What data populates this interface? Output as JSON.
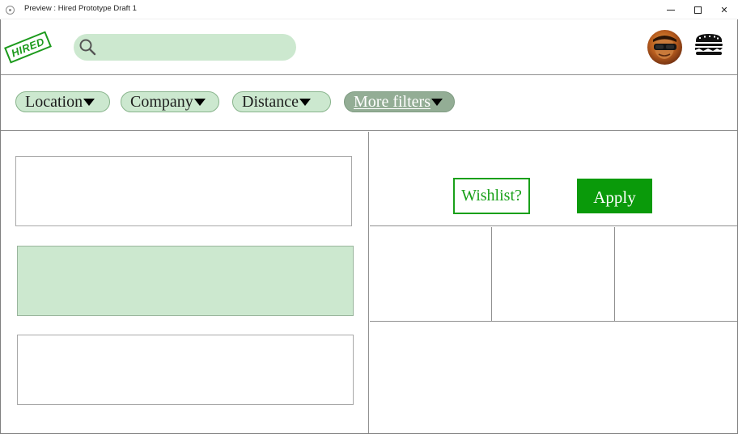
{
  "window": {
    "title": "Preview : Hired Prototype Draft 1",
    "controls": {
      "minimize": "",
      "maximize": "",
      "close": "✕"
    }
  },
  "header": {
    "logo_text": "HIRED",
    "search": {
      "value": "",
      "placeholder": ""
    },
    "avatar_icon": "user-avatar",
    "menu_icon": "hamburger-menu-icon"
  },
  "filters": [
    {
      "label": "Location"
    },
    {
      "label": "Company"
    },
    {
      "label": "Distance"
    },
    {
      "label": "More filters"
    }
  ],
  "actions": {
    "wishlist_label": "Wishlist?",
    "apply_label": "Apply"
  },
  "colors": {
    "accent_light": "#cce8cf",
    "accent_dark": "#0a9a0a",
    "more_filters": "#93ad95",
    "stamp": "#1c9a1c"
  }
}
